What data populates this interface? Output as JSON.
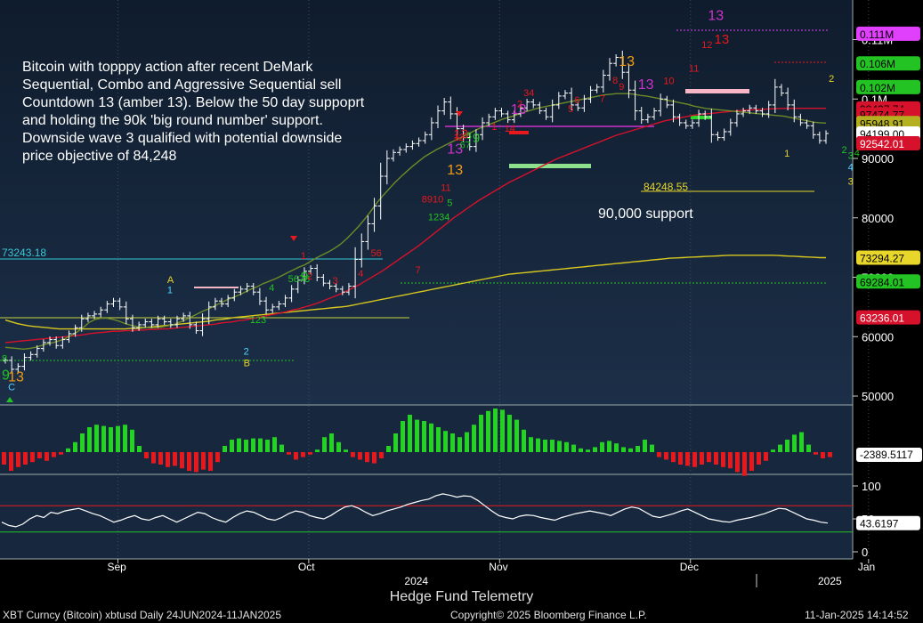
{
  "chart_data": {
    "type": "candlestick",
    "title": "",
    "xlabel": "",
    "ylabel": "",
    "annotation_text": [
      "Bitcoin with topppy action after recent DeMark",
      "Sequential, Combo and Aggressive Sequential sell",
      "Countdown 13 (amber 13).  Below the 50 day suppoprt",
      "and holding the 90k 'big round number' support.",
      "Downside wave 3 qualified with potential downside",
      "price objective of 84,248"
    ],
    "support_label": "90,000 support",
    "objective_label": "84248.55",
    "level_label_left": "73243.18",
    "ylim": [
      48000,
      115000
    ],
    "y_ticks": [
      {
        "v": 50000,
        "label": "50000"
      },
      {
        "v": 60000,
        "label": "60000"
      },
      {
        "v": 70000,
        "label": "70000"
      },
      {
        "v": 80000,
        "label": "80000"
      },
      {
        "v": 90000,
        "label": "90000"
      },
      {
        "v": 100000,
        "label": "0.1M"
      },
      {
        "v": 110000,
        "label": "0.11M"
      }
    ],
    "right_boxes": [
      {
        "v": 111000,
        "label": "0.111M",
        "bg": "#e040fb",
        "fg": "#000000"
      },
      {
        "v": 106000,
        "label": "0.106M",
        "bg": "#22c322",
        "fg": "#000000"
      },
      {
        "v": 102000,
        "label": "0.102M",
        "bg": "#22c322",
        "fg": "#000000"
      },
      {
        "v": 98400,
        "label": "98437.74",
        "bg": "#d6112b",
        "fg": "#000000"
      },
      {
        "v": 97400,
        "label": "97474.77",
        "bg": "#d6112b",
        "fg": "#000000"
      },
      {
        "v": 95950,
        "label": "95948.91",
        "bg": "#b5b020",
        "fg": "#000000"
      },
      {
        "v": 94199,
        "label": "94199.00",
        "bg": "#ffffff",
        "fg": "#000000"
      },
      {
        "v": 92542,
        "label": "92542.01",
        "bg": "#d6112b",
        "fg": "#ffffff"
      },
      {
        "v": 73294,
        "label": "73294.27",
        "bg": "#e8d62a",
        "fg": "#000000"
      },
      {
        "v": 69284,
        "label": "69284.01",
        "bg": "#22c322",
        "fg": "#000000"
      },
      {
        "v": 63236,
        "label": "63236.01",
        "bg": "#d6112b",
        "fg": "#ffffff"
      }
    ],
    "x_ticks": [
      {
        "i": 10,
        "label": "Sep"
      },
      {
        "i": 40,
        "label": "Oct"
      },
      {
        "i": 70,
        "label": "Nov"
      },
      {
        "i": 100,
        "label": "Dec"
      },
      {
        "i": 128,
        "label": "Jan"
      }
    ],
    "year_labels": [
      {
        "i": 57,
        "label": "2024"
      },
      {
        "i": 122,
        "label": "2025"
      }
    ],
    "sma_short": [
      58200,
      58100,
      58000,
      57900,
      58000,
      58200,
      58500,
      58800,
      59000,
      59300,
      59700,
      60200,
      60800,
      61500,
      62400,
      62900,
      63100,
      63100,
      62900,
      62600,
      62200,
      61900,
      61700,
      61600,
      61500,
      61500,
      61600,
      61800,
      62000,
      62400,
      62800,
      63300,
      63800,
      64300,
      64700,
      65200,
      65700,
      66200,
      66600,
      67000,
      67500,
      68000,
      68400,
      68900,
      69300,
      69700,
      70200,
      70700,
      71200,
      71700,
      72100,
      72700,
      73300,
      73800,
      74300,
      74900,
      75600,
      76500,
      77500,
      78600,
      79800,
      81100,
      82500,
      83700,
      84800,
      85900,
      86900,
      87800,
      88700,
      89500,
      90300,
      90900,
      91500,
      92000,
      92500,
      93000,
      93500,
      94000,
      94500,
      95000,
      95400,
      95800,
      96200,
      96600,
      96900,
      97200,
      97600,
      97900,
      98200,
      98500,
      98700,
      98900,
      99100,
      99300,
      99500,
      99700,
      99900,
      100100,
      100300,
      100500,
      100700,
      100800,
      100900,
      100900,
      100900,
      100800,
      100600,
      100500,
      100300,
      100100,
      99900,
      99700,
      99500,
      99300,
      99100,
      98800,
      98600,
      98400,
      98300,
      98200,
      98100,
      98000,
      97900,
      97800,
      97700,
      97600,
      97500,
      97400,
      97300,
      97200,
      97100,
      96900,
      96700,
      96500,
      96300,
      96100,
      96000,
      95950
    ],
    "sma_mid": [
      59000,
      59100,
      59200,
      59300,
      59400,
      59500,
      59600,
      59700,
      59800,
      59900,
      60000,
      60100,
      60200,
      60300,
      60500,
      60600,
      60700,
      60800,
      60900,
      60900,
      61000,
      61000,
      61100,
      61100,
      61200,
      61200,
      61300,
      61300,
      61400,
      61500,
      61600,
      61700,
      61800,
      61900,
      62000,
      62100,
      62300,
      62400,
      62500,
      62700,
      62800,
      63000,
      63200,
      63400,
      63600,
      63800,
      64000,
      64200,
      64500,
      64700,
      65000,
      65300,
      65600,
      66000,
      66400,
      66800,
      67200,
      67700,
      68200,
      68700,
      69300,
      69900,
      70500,
      71100,
      71800,
      72500,
      73200,
      73900,
      74600,
      75300,
      76100,
      76900,
      77700,
      78500,
      79300,
      80100,
      80800,
      81500,
      82200,
      82900,
      83500,
      84100,
      84700,
      85300,
      85900,
      86400,
      86900,
      87400,
      87900,
      88400,
      88900,
      89400,
      89900,
      90300,
      90700,
      91100,
      91500,
      91900,
      92300,
      92700,
      93100,
      93500,
      93900,
      94200,
      94500,
      94800,
      95100,
      95400,
      95700,
      96000,
      96300,
      96500,
      96700,
      96900,
      97100,
      97300,
      97400,
      97500,
      97600,
      97700,
      97800,
      97900,
      98000,
      98100,
      98150,
      98200,
      98250,
      98300,
      98350,
      98400,
      98420,
      98430,
      98440,
      98440,
      98440,
      98440,
      98440,
      98438
    ],
    "sma_long": [
      62800,
      62500,
      62200,
      62000,
      61800,
      61700,
      61600,
      61500,
      61400,
      61300,
      61300,
      61300,
      61300,
      61300,
      61300,
      61300,
      61300,
      61300,
      61300,
      61300,
      61300,
      61400,
      61400,
      61500,
      61600,
      61700,
      61800,
      61900,
      62000,
      62100,
      62200,
      62300,
      62400,
      62500,
      62600,
      62800,
      62900,
      63000,
      63200,
      63300,
      63400,
      63500,
      63600,
      63700,
      63800,
      63900,
      64000,
      64100,
      64200,
      64300,
      64400,
      64500,
      64600,
      64700,
      64800,
      64900,
      65000,
      65100,
      65300,
      65500,
      65700,
      65900,
      66100,
      66300,
      66500,
      66700,
      66900,
      67100,
      67300,
      67500,
      67700,
      67900,
      68100,
      68300,
      68500,
      68700,
      68900,
      69100,
      69300,
      69500,
      69700,
      69900,
      70100,
      70300,
      70500,
      70600,
      70700,
      70800,
      70900,
      71000,
      71100,
      71200,
      71300,
      71400,
      71500,
      71600,
      71700,
      71800,
      71900,
      72000,
      72100,
      72200,
      72300,
      72400,
      72500,
      72600,
      72700,
      72800,
      72900,
      73000,
      73100,
      73200,
      73250,
      73300,
      73350,
      73400,
      73450,
      73500,
      73550,
      73600,
      73650,
      73700,
      73700,
      73700,
      73700,
      73700,
      73700,
      73700,
      73700,
      73650,
      73600,
      73550,
      73500,
      73450,
      73400,
      73350,
      73300,
      73294
    ],
    "ohlc_close_path": [
      56000,
      54500,
      55000,
      56500,
      57000,
      58000,
      59000,
      59500,
      58500,
      59500,
      60500,
      61500,
      63000,
      63500,
      63800,
      64500,
      65500,
      66000,
      65000,
      63000,
      61500,
      62000,
      62500,
      62000,
      63000,
      62500,
      62000,
      63000,
      63500,
      62000,
      61000,
      63000,
      65000,
      66000,
      65500,
      66500,
      67500,
      68000,
      68500,
      67500,
      66000,
      64500,
      65000,
      65500,
      66500,
      68000,
      69500,
      71000,
      71500,
      70000,
      69000,
      68500,
      68000,
      67500,
      68500,
      73000,
      76000,
      79000,
      82000,
      87000,
      90000,
      91000,
      91500,
      92000,
      92500,
      93000,
      94000,
      96000,
      98000,
      99500,
      97500,
      95000,
      93500,
      92000,
      94000,
      96000,
      97000,
      98000,
      97500,
      96500,
      97500,
      98500,
      99500,
      99000,
      98000,
      97000,
      99000,
      100500,
      101000,
      99000,
      98500,
      100000,
      101500,
      102000,
      104000,
      106000,
      107000,
      104500,
      101500,
      98000,
      96500,
      97000,
      98000,
      100000,
      99000,
      97000,
      96000,
      95500,
      96000,
      97500,
      97000,
      94000,
      93500,
      94500,
      96000,
      97500,
      98000,
      98500,
      98000,
      97500,
      99000,
      102000,
      101000,
      99000,
      97000,
      96000,
      95500,
      94000,
      93000,
      94199
    ],
    "indicator1": [
      -1,
      -1.5,
      -1.2,
      -1,
      -0.8,
      -0.5,
      -0.7,
      -0.4,
      -0.2,
      0.3,
      0.8,
      1.5,
      2,
      2.2,
      2.1,
      2,
      2.1,
      2.2,
      1.8,
      0.5,
      -0.5,
      -0.9,
      -1,
      -1.2,
      -1.1,
      -1.3,
      -1.5,
      -1.6,
      -1.4,
      -1.5,
      -0.8,
      0.5,
      1,
      1.1,
      1,
      1.1,
      1.1,
      1,
      1.2,
      0.6,
      -0.2,
      -0.6,
      -0.4,
      -0.2,
      0.2,
      1.2,
      1.5,
      0.8,
      0.2,
      -0.4,
      -0.6,
      -0.8,
      -0.9,
      -0.5,
      0.5,
      1.5,
      2.5,
      3,
      2.6,
      2.5,
      2.3,
      2,
      1.7,
      1.5,
      1.2,
      1.6,
      2.2,
      3,
      3.3,
      3.5,
      3.4,
      3,
      2.6,
      1.8,
      1.2,
      1.1,
      1,
      1,
      0.9,
      0.8,
      0.6,
      0.3,
      0.2,
      0.4,
      0.8,
      0.9,
      0.7,
      0.4,
      0.3,
      0.5,
      1,
      0.6,
      -0.4,
      -0.6,
      -0.8,
      -1,
      -1.1,
      -1.2,
      -1,
      -0.8,
      -1,
      -1.2,
      -1.3,
      -1.6,
      -1.9,
      -1.5,
      -1,
      -0.7,
      0.2,
      0.6,
      1,
      1.4,
      1.6,
      0.6,
      -0.2,
      -0.5,
      -0.4
    ],
    "indicator2": [
      45,
      40,
      38,
      42,
      50,
      55,
      52,
      60,
      58,
      62,
      64,
      66,
      62,
      58,
      55,
      50,
      45,
      48,
      52,
      55,
      50,
      48,
      52,
      55,
      50,
      45,
      50,
      55,
      60,
      58,
      52,
      48,
      45,
      52,
      58,
      62,
      60,
      55,
      50,
      48,
      52,
      58,
      62,
      60,
      55,
      52,
      50,
      55,
      62,
      68,
      70,
      66,
      60,
      55,
      58,
      62,
      65,
      68,
      72,
      75,
      78,
      80,
      85,
      88,
      86,
      83,
      85,
      84,
      78,
      70,
      62,
      55,
      52,
      50,
      54,
      56,
      55,
      52,
      50,
      48,
      52,
      55,
      58,
      60,
      62,
      60,
      58,
      55,
      60,
      65,
      68,
      66,
      60,
      54,
      52,
      55,
      58,
      62,
      65,
      60,
      55,
      50,
      48,
      46,
      45,
      48,
      50,
      52,
      55,
      58,
      62,
      66,
      65,
      60,
      55,
      50,
      48,
      45,
      43.6
    ]
  },
  "indicator1_label": "-2389.5117",
  "indicator2_label": "43.6197",
  "indicator2_ticks": [
    {
      "v": 100,
      "label": "100"
    },
    {
      "v": 50,
      "label": "50"
    },
    {
      "v": 0,
      "label": "0"
    }
  ],
  "footer": {
    "center_title": "Hedge Fund Telemetry",
    "left": "XBT Curncy (Bitcoin) xbtusd  Daily 24JUN2024-11JAN2025",
    "center": "Copyright© 2025 Bloomberg Finance L.P.",
    "right": "11-Jan-2025 14:14:52"
  },
  "demark_labels": [
    {
      "i": 0,
      "v": 52800,
      "t": "9",
      "c": "#22c322",
      "s": 16
    },
    {
      "i": 1,
      "v": 52500,
      "t": "13",
      "c": "#f39c12",
      "s": 16
    },
    {
      "i": 1,
      "v": 51000,
      "t": "C",
      "c": "#4fd2ff",
      "s": 11
    },
    {
      "i": 0,
      "v": 55800,
      "t": "8",
      "c": "#22c322",
      "s": 11
    },
    {
      "i": 26,
      "v": 69000,
      "t": "A",
      "c": "#e8d62a",
      "s": 11
    },
    {
      "i": 26,
      "v": 67300,
      "t": "1",
      "c": "#4fd2ff",
      "s": 11
    },
    {
      "i": 38,
      "v": 57000,
      "t": "2",
      "c": "#4fd2ff",
      "s": 11
    },
    {
      "i": 38,
      "v": 55000,
      "t": "B",
      "c": "#e8d62a",
      "s": 11
    },
    {
      "i": 39,
      "v": 62300,
      "t": "123",
      "c": "#22c322",
      "s": 11
    },
    {
      "i": 42,
      "v": 67700,
      "t": "4",
      "c": "#22c322",
      "s": 11
    },
    {
      "i": 45,
      "v": 69200,
      "t": "5678",
      "c": "#22c322",
      "s": 11
    },
    {
      "i": 47,
      "v": 69400,
      "t": "9",
      "c": "#22c322",
      "s": 15
    },
    {
      "i": 48,
      "v": 69600,
      "t": "2",
      "c": "#e8181c",
      "s": 11
    },
    {
      "i": 47,
      "v": 73100,
      "t": "1",
      "c": "#e8181c",
      "s": 11
    },
    {
      "i": 52,
      "v": 68900,
      "t": "3",
      "c": "#e8181c",
      "s": 11
    },
    {
      "i": 56,
      "v": 70100,
      "t": "4",
      "c": "#e8181c",
      "s": 11
    },
    {
      "i": 58,
      "v": 73500,
      "t": "56",
      "c": "#e8181c",
      "s": 11
    },
    {
      "i": 65,
      "v": 70700,
      "t": "7",
      "c": "#e8181c",
      "s": 11
    },
    {
      "i": 67,
      "v": 79600,
      "t": "1234",
      "c": "#22c322",
      "s": 11
    },
    {
      "i": 66,
      "v": 82600,
      "t": "8910",
      "c": "#e8181c",
      "s": 11
    },
    {
      "i": 70,
      "v": 82000,
      "t": "5",
      "c": "#22c322",
      "s": 11
    },
    {
      "i": 69,
      "v": 84500,
      "t": "11",
      "c": "#e8181c",
      "s": 11
    },
    {
      "i": 70,
      "v": 87300,
      "t": "13",
      "c": "#f39c12",
      "s": 16
    },
    {
      "i": 70,
      "v": 90800,
      "t": "13",
      "c": "#cc33cc",
      "s": 16
    },
    {
      "i": 71,
      "v": 93000,
      "t": "12",
      "c": "#e8181c",
      "s": 11
    },
    {
      "i": 72,
      "v": 91700,
      "t": "67",
      "c": "#22c322",
      "s": 11
    },
    {
      "i": 73,
      "v": 93300,
      "t": "8",
      "c": "#22c322",
      "s": 11
    },
    {
      "i": 74,
      "v": 92700,
      "t": "9",
      "c": "#22c322",
      "s": 15
    },
    {
      "i": 71,
      "v": 93400,
      "t": "13",
      "c": "#e8181c",
      "s": 15
    },
    {
      "i": 77,
      "v": 94800,
      "t": "1",
      "c": "#e8181c",
      "s": 11
    },
    {
      "i": 80,
      "v": 97500,
      "t": "13",
      "c": "#cc33cc",
      "s": 16
    },
    {
      "i": 79,
      "v": 94500,
      "t": "14",
      "c": "#e8181c",
      "s": 11
    },
    {
      "i": 81,
      "v": 98600,
      "t": "2",
      "c": "#e8181c",
      "s": 11
    },
    {
      "i": 82,
      "v": 100500,
      "t": "34",
      "c": "#e8181c",
      "s": 11
    },
    {
      "i": 89,
      "v": 97800,
      "t": "5",
      "c": "#e8181c",
      "s": 11
    },
    {
      "i": 90,
      "v": 99300,
      "t": "6",
      "c": "#e8181c",
      "s": 11
    },
    {
      "i": 94,
      "v": 99500,
      "t": "7",
      "c": "#e8181c",
      "s": 11
    },
    {
      "i": 96,
      "v": 102600,
      "t": "8",
      "c": "#e8181c",
      "s": 11
    },
    {
      "i": 97,
      "v": 105600,
      "t": "13",
      "c": "#f39c12",
      "s": 16
    },
    {
      "i": 97,
      "v": 101500,
      "t": "9",
      "c": "#e8181c",
      "s": 11
    },
    {
      "i": 100,
      "v": 101700,
      "t": "13",
      "c": "#cc33cc",
      "s": 16
    },
    {
      "i": 104,
      "v": 102500,
      "t": "10",
      "c": "#e8181c",
      "s": 11
    },
    {
      "i": 108,
      "v": 104600,
      "t": "11",
      "c": "#e8181c",
      "s": 11
    },
    {
      "i": 110,
      "v": 108600,
      "t": "12",
      "c": "#e8181c",
      "s": 11
    },
    {
      "i": 112,
      "v": 109300,
      "t": "13",
      "c": "#e8181c",
      "s": 15
    },
    {
      "i": 111,
      "v": 113300,
      "t": "13",
      "c": "#cc33cc",
      "s": 16
    },
    {
      "i": 123,
      "v": 90300,
      "t": "1",
      "c": "#e8d62a",
      "s": 11
    },
    {
      "i": 130,
      "v": 102900,
      "t": "2",
      "c": "#e8d62a",
      "s": 11
    },
    {
      "i": 132,
      "v": 90900,
      "t": "2",
      "c": "#22c322",
      "s": 11
    },
    {
      "i": 133,
      "v": 89900,
      "t": "3",
      "c": "#22c322",
      "s": 11
    },
    {
      "i": 134,
      "v": 90400,
      "t": "4",
      "c": "#22c322",
      "s": 11
    },
    {
      "i": 136,
      "v": 92000,
      "t": "5",
      "c": "#22c322",
      "s": 11
    },
    {
      "i": 133,
      "v": 88000,
      "t": "4",
      "c": "#4fd2ff",
      "s": 11
    },
    {
      "i": 133,
      "v": 85600,
      "t": "3",
      "c": "#e8d62a",
      "s": 11
    }
  ]
}
